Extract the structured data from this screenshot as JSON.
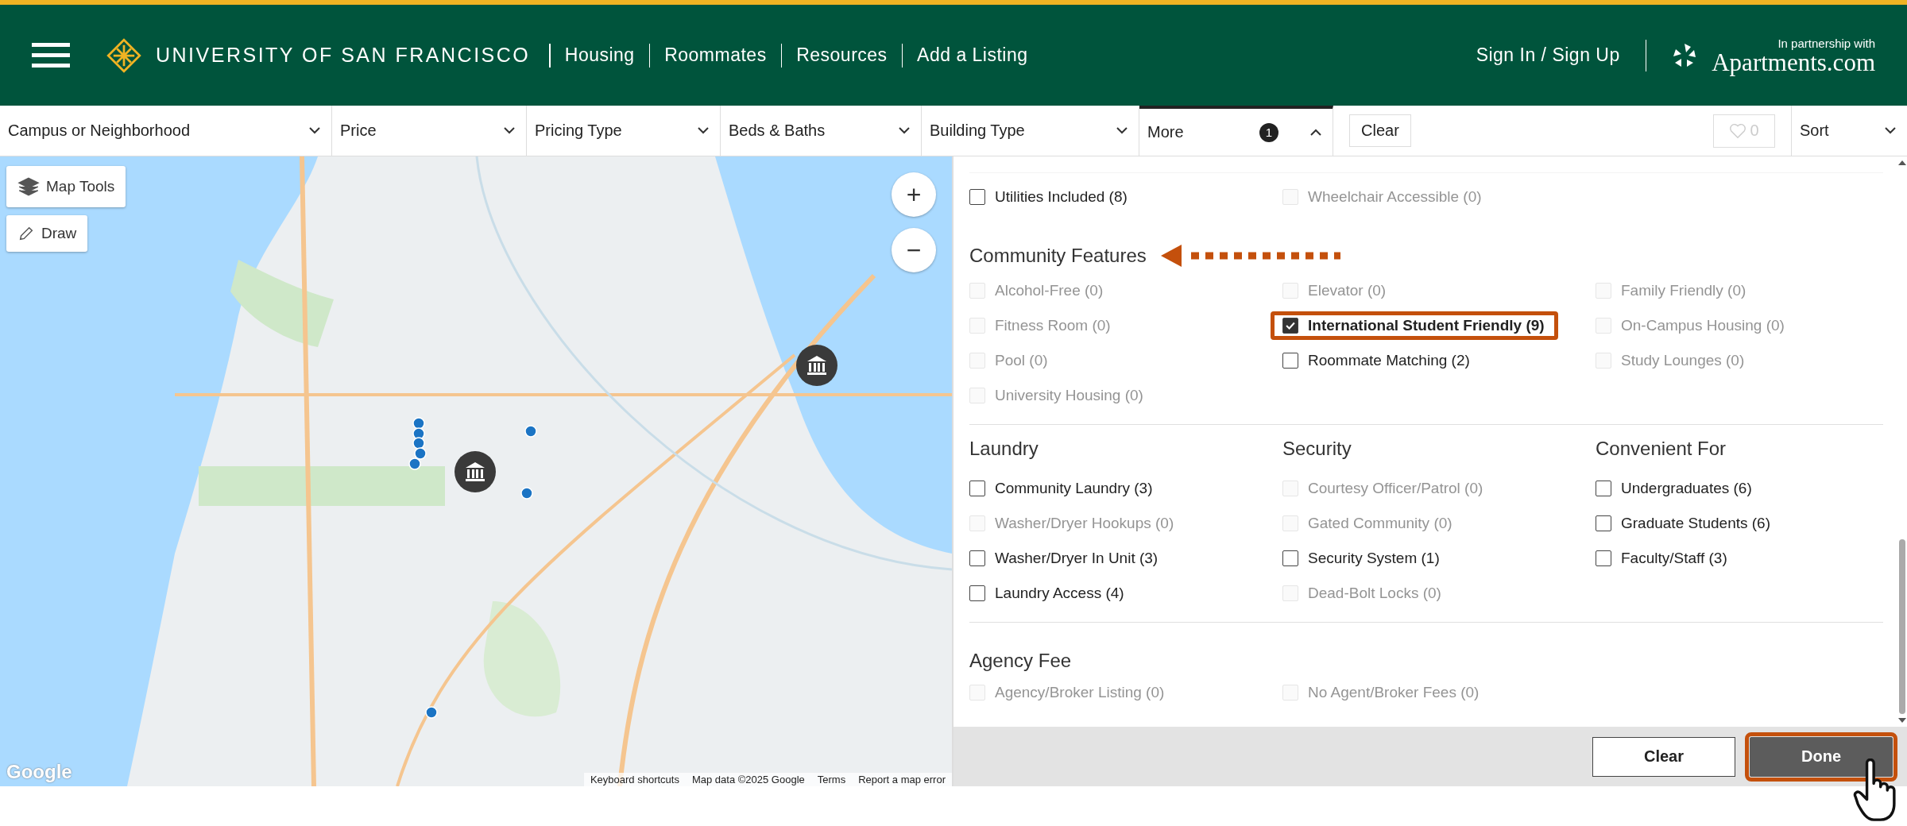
{
  "header": {
    "brand": "UNIVERSITY OF SAN FRANCISCO",
    "nav": [
      "Housing",
      "Roommates",
      "Resources",
      "Add a Listing"
    ],
    "sign_in": "Sign In / Sign Up",
    "partner_caption": "In partnership with",
    "partner_name": "Apartments.com"
  },
  "filters": [
    {
      "label": "Campus or Neighborhood",
      "expanded": false
    },
    {
      "label": "Price",
      "expanded": false
    },
    {
      "label": "Pricing Type",
      "expanded": false
    },
    {
      "label": "Beds & Baths",
      "expanded": false
    },
    {
      "label": "Building Type",
      "expanded": false
    },
    {
      "label": "More",
      "badge": "1",
      "expanded": true
    }
  ],
  "clear_filters": "Clear",
  "favorites": {
    "count": "0"
  },
  "sort": "Sort",
  "map": {
    "tools": "Map Tools",
    "draw": "Draw",
    "zoom_in": "+",
    "zoom_out": "−",
    "logo": "Google",
    "attribution": [
      "Keyboard shortcuts",
      "Map data ©2025 Google",
      "Terms",
      "Report a map error"
    ]
  },
  "panel": {
    "blocks": [
      {
        "kind": "grid",
        "options": [
          {
            "label": "Utilities Included (8)",
            "checked": false,
            "disabled": false,
            "highlighted": false
          },
          {
            "label": "Wheelchair Accessible (0)",
            "checked": false,
            "disabled": true,
            "highlighted": false
          }
        ]
      },
      {
        "kind": "grid",
        "title": "Community Features",
        "annotated": true,
        "options": [
          {
            "label": "Alcohol-Free (0)",
            "checked": false,
            "disabled": true,
            "highlighted": false
          },
          {
            "label": "Elevator (0)",
            "checked": false,
            "disabled": true,
            "highlighted": false
          },
          {
            "label": "Family Friendly (0)",
            "checked": false,
            "disabled": true,
            "highlighted": false
          },
          {
            "label": "Fitness Room (0)",
            "checked": false,
            "disabled": true,
            "highlighted": false
          },
          {
            "label": "International Student Friendly (9)",
            "checked": true,
            "disabled": false,
            "highlighted": true
          },
          {
            "label": "On-Campus Housing (0)",
            "checked": false,
            "disabled": true,
            "highlighted": false
          },
          {
            "label": "Pool (0)",
            "checked": false,
            "disabled": true,
            "highlighted": false
          },
          {
            "label": "Roommate Matching (2)",
            "checked": false,
            "disabled": false,
            "highlighted": false
          },
          {
            "label": "Study Lounges (0)",
            "checked": false,
            "disabled": true,
            "highlighted": false
          },
          {
            "label": "University Housing (0)",
            "checked": false,
            "disabled": true,
            "highlighted": false
          }
        ]
      },
      {
        "kind": "columns",
        "columns": [
          {
            "title": "Laundry",
            "options": [
              {
                "label": "Community Laundry (3)",
                "checked": false,
                "disabled": false,
                "highlighted": false
              },
              {
                "label": "Washer/Dryer Hookups (0)",
                "checked": false,
                "disabled": true,
                "highlighted": false
              },
              {
                "label": "Washer/Dryer In Unit (3)",
                "checked": false,
                "disabled": false,
                "highlighted": false
              },
              {
                "label": "Laundry Access (4)",
                "checked": false,
                "disabled": false,
                "highlighted": false
              }
            ]
          },
          {
            "title": "Security",
            "options": [
              {
                "label": "Courtesy Officer/Patrol (0)",
                "checked": false,
                "disabled": true,
                "highlighted": false
              },
              {
                "label": "Gated Community (0)",
                "checked": false,
                "disabled": true,
                "highlighted": false
              },
              {
                "label": "Security System (1)",
                "checked": false,
                "disabled": false,
                "highlighted": false
              },
              {
                "label": "Dead-Bolt Locks (0)",
                "checked": false,
                "disabled": true,
                "highlighted": false
              }
            ]
          },
          {
            "title": "Convenient For",
            "options": [
              {
                "label": "Undergraduates (6)",
                "checked": false,
                "disabled": false,
                "highlighted": false
              },
              {
                "label": "Graduate Students (6)",
                "checked": false,
                "disabled": false,
                "highlighted": false
              },
              {
                "label": "Faculty/Staff (3)",
                "checked": false,
                "disabled": false,
                "highlighted": false
              }
            ]
          }
        ]
      },
      {
        "kind": "grid",
        "title": "Agency Fee",
        "options": [
          {
            "label": "Agency/Broker Listing (0)",
            "checked": false,
            "disabled": true,
            "highlighted": false
          },
          {
            "label": "No Agent/Broker Fees (0)",
            "checked": false,
            "disabled": true,
            "highlighted": false
          }
        ]
      }
    ],
    "footer": {
      "clear": "Clear",
      "done": "Done",
      "done_highlighted": true
    }
  }
}
